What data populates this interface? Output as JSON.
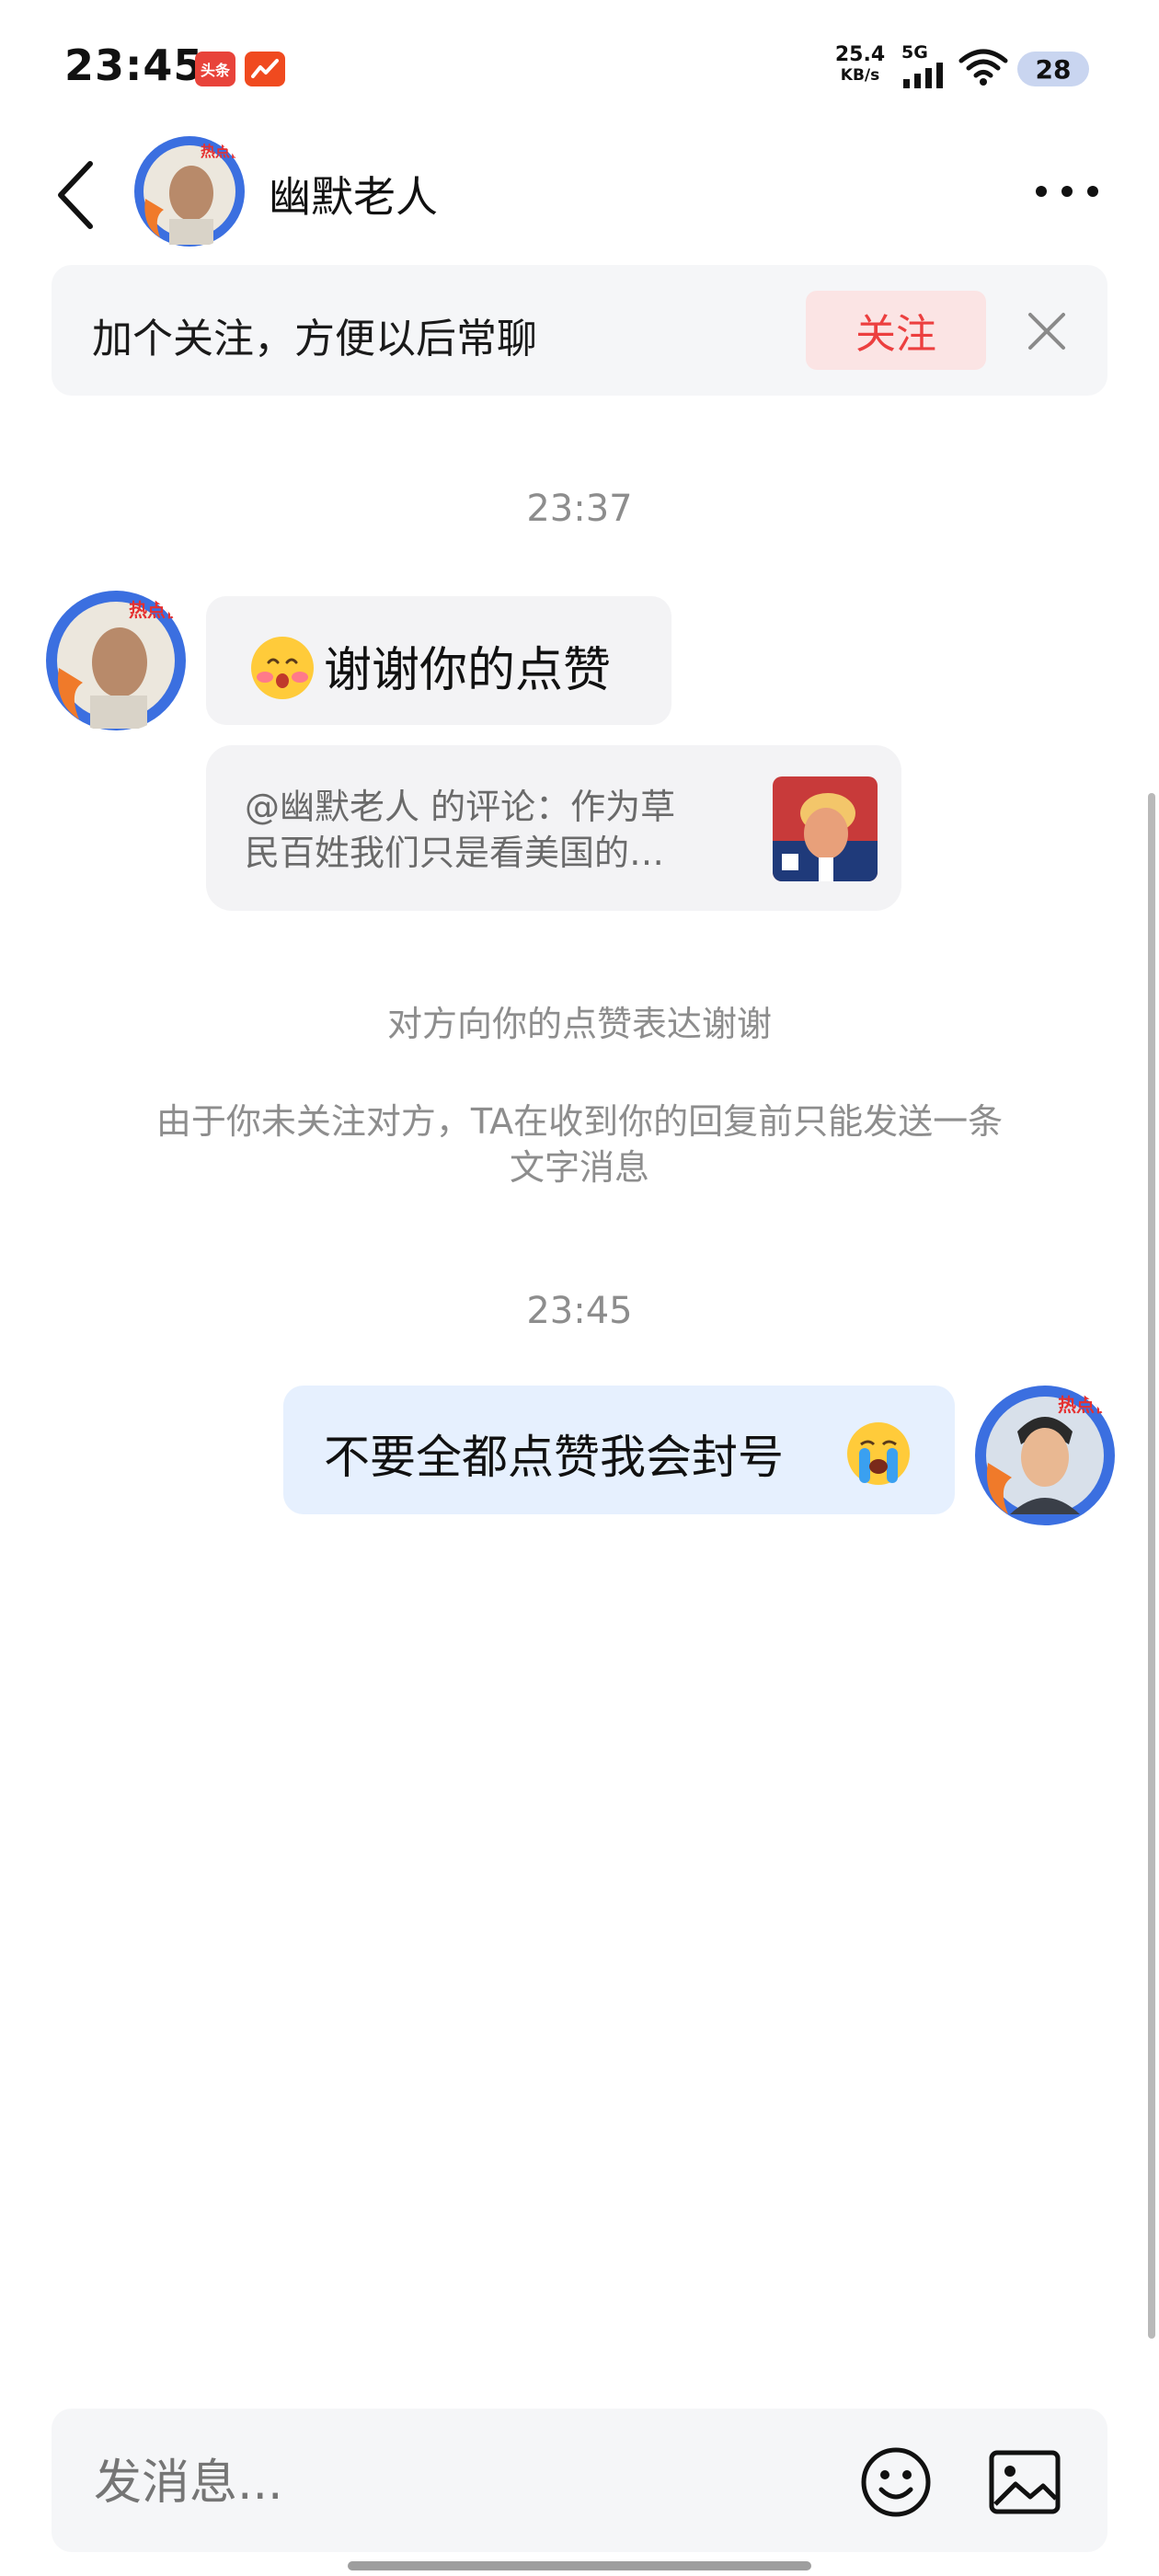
{
  "status_bar": {
    "time": "23:45",
    "network_speed": "25.4",
    "network_unit": "KB/s",
    "network_type": "5G",
    "battery": "28",
    "app_icons": [
      "toutiao-app-icon",
      "trend-app-icon"
    ],
    "toutiao_label": "头条"
  },
  "header": {
    "contact_name": "幽默老人",
    "avatar_badge": "热点侠",
    "icons": [
      "back-arrow-icon",
      "more-dots-icon"
    ]
  },
  "follow_banner": {
    "text": "加个关注，方便以后常聊",
    "button_label": "关注",
    "close_icon": "close-icon"
  },
  "messages": {
    "time_1": "23:37",
    "incoming_text": "谢谢你的点赞",
    "incoming_emoji": "blushing-face-emoji",
    "comment_line1": "@幽默老人 的评论：作为草",
    "comment_line2": "民百姓我们只是看美国的…",
    "system_note_1": "对方向你的点赞表达谢谢",
    "system_note_2_line1": "由于你未关注对方，TA在收到你的回复前只能发送一条",
    "system_note_2_line2": "文字消息",
    "time_2": "23:45",
    "outgoing_text": "不要全都点赞我会封号",
    "outgoing_emoji": "crying-face-emoji"
  },
  "input_bar": {
    "placeholder": "发消息...",
    "icons": [
      "emoji-icon",
      "image-icon"
    ]
  },
  "colors": {
    "accent_red": "#ec3f3f",
    "follow_bg": "#fbe4e4",
    "outgoing_bubble": "#e6f0fe",
    "incoming_bubble": "#f3f3f5",
    "badge_ring": "#3b6fe0"
  }
}
